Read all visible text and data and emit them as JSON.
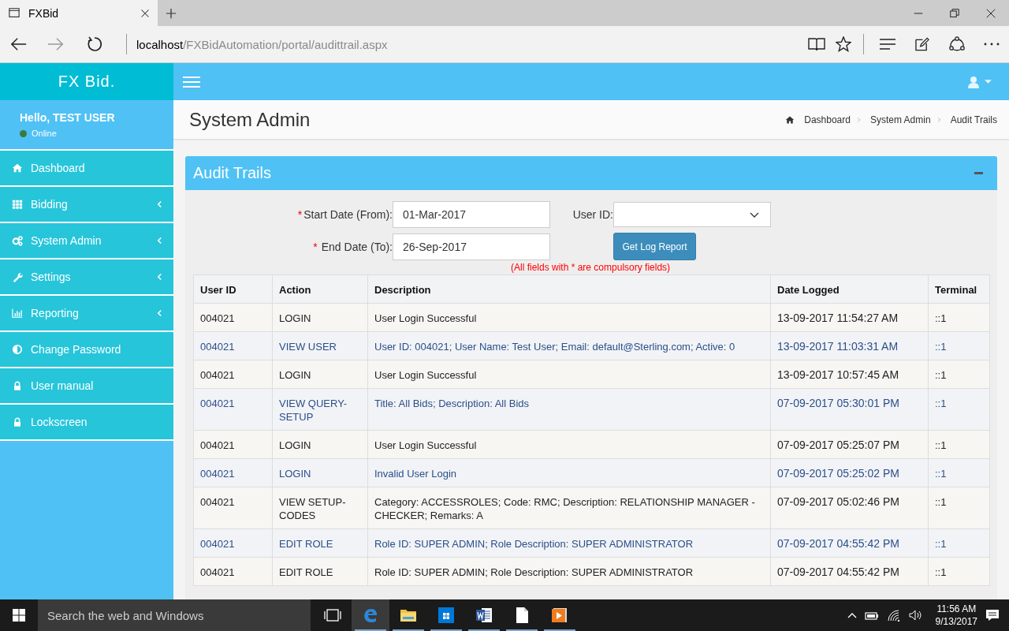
{
  "browser": {
    "tabs": [
      {
        "title": "FXBid",
        "selected": true
      }
    ],
    "address": {
      "host": "localhost",
      "path": "/FXBidAutomation/portal/audittrail.aspx"
    }
  },
  "app": {
    "logo": "FX Bid.",
    "user": {
      "greeting": "Hello, TEST USER",
      "status": "Online"
    },
    "sidebar": {
      "items": [
        {
          "label": "Dashboard",
          "submenu": false
        },
        {
          "label": "Bidding",
          "submenu": true
        },
        {
          "label": "System Admin",
          "submenu": true
        },
        {
          "label": "Settings",
          "submenu": true
        },
        {
          "label": "Reporting",
          "submenu": true
        },
        {
          "label": "Change Password",
          "submenu": false
        },
        {
          "label": "User manual",
          "submenu": false
        },
        {
          "label": "Lockscreen",
          "submenu": false
        }
      ]
    },
    "page_title": "System Admin",
    "breadcrumbs": [
      "Dashboard",
      "System Admin",
      "Audit Trails"
    ],
    "panel": {
      "title": "Audit Trails",
      "form": {
        "start_date": {
          "required_mark": "*",
          "label": "Start Date (From):",
          "value": "01-Mar-2017"
        },
        "end_date": {
          "required_mark": "*",
          "label": "End Date (To):",
          "value": "26-Sep-2017"
        },
        "user_id": {
          "label": "User ID:"
        },
        "button": "Get Log Report",
        "note": "(All fields with * are compulsory fields)"
      },
      "table": {
        "columns": [
          "User ID",
          "Action",
          "Description",
          "Date Logged",
          "Terminal"
        ],
        "rows": [
          {
            "highlighted": false,
            "cells": [
              "004021",
              "LOGIN",
              "User Login Successful",
              "13-09-2017 11:54:27 AM",
              "::1"
            ]
          },
          {
            "highlighted": true,
            "cells": [
              "004021",
              "VIEW USER",
              "User ID: 004021; User Name: Test User; Email: default@Sterling.com; Active: 0",
              "13-09-2017 11:03:31 AM",
              "::1"
            ]
          },
          {
            "highlighted": false,
            "cells": [
              "004021",
              "LOGIN",
              "User Login Successful",
              "13-09-2017 10:57:45 AM",
              "::1"
            ]
          },
          {
            "highlighted": true,
            "cells": [
              "004021",
              "VIEW QUERY-SETUP",
              "Title: All Bids; Description: All Bids",
              "07-09-2017 05:30:01 PM",
              "::1"
            ]
          },
          {
            "highlighted": false,
            "cells": [
              "004021",
              "LOGIN",
              "User Login Successful",
              "07-09-2017 05:25:07 PM",
              "::1"
            ]
          },
          {
            "highlighted": true,
            "cells": [
              "004021",
              "LOGIN",
              "Invalid User Login",
              "07-09-2017 05:25:02 PM",
              "::1"
            ]
          },
          {
            "highlighted": false,
            "cells": [
              "004021",
              "VIEW SETUP-CODES",
              "Category: ACCESSROLES; Code: RMC; Description: RELATIONSHIP MANAGER - CHECKER; Remarks: A",
              "07-09-2017 05:02:46 PM",
              "::1"
            ]
          },
          {
            "highlighted": true,
            "cells": [
              "004021",
              "EDIT ROLE",
              "Role ID: SUPER ADMIN; Role Description: SUPER ADMINISTRATOR",
              "07-09-2017 04:55:42 PM",
              "::1"
            ]
          },
          {
            "highlighted": false,
            "cells": [
              "004021",
              "EDIT ROLE",
              "Role ID: SUPER ADMIN; Role Description: SUPER ADMINISTRATOR",
              "07-09-2017 04:55:42 PM",
              "::1"
            ]
          }
        ]
      }
    }
  },
  "taskbar": {
    "search_placeholder": "Search the web and Windows",
    "time": "11:56 AM",
    "date": "9/13/2017"
  }
}
